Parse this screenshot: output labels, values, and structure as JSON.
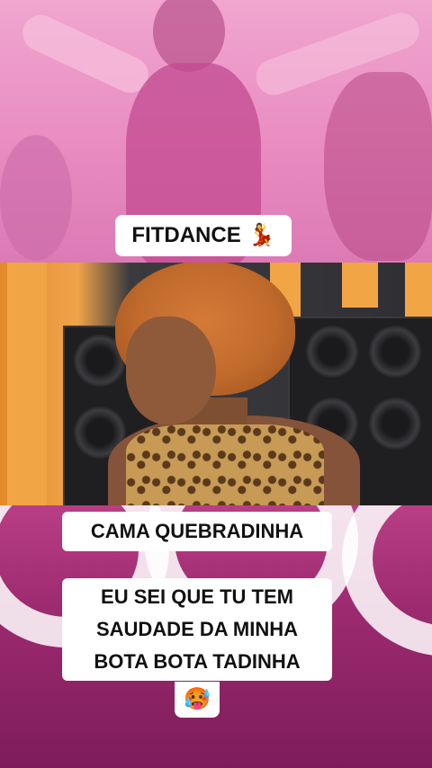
{
  "video": {
    "title_label": "FITDANCE",
    "title_emoji": "💃",
    "song_title": "CAMA QUEBRADINHA",
    "lyrics": [
      "EU SEI QUE TU TEM",
      "SAUDADE DA MINHA",
      "BOTA BOTA TADINHA"
    ],
    "reaction_emoji": "🥵"
  },
  "colors": {
    "top_background": "#e98cc2",
    "bottom_background": "#9c2a6f",
    "label_background": "#ffffff",
    "label_text": "#111111"
  }
}
